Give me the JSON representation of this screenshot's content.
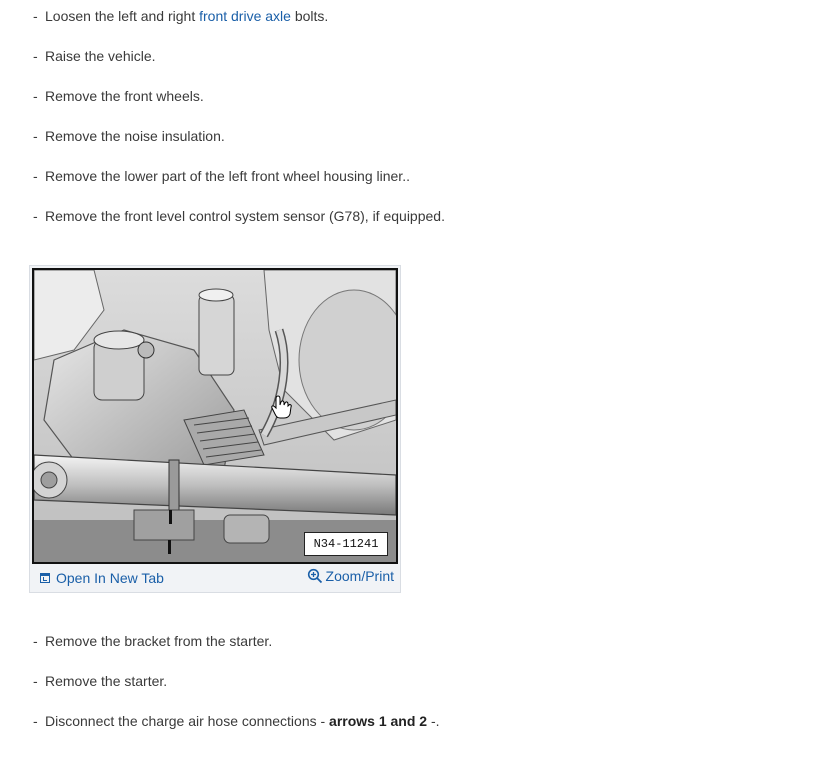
{
  "steps_top": [
    {
      "prefix": "Loosen the left and right ",
      "link": "front drive axle",
      "suffix": " bolts."
    },
    {
      "text": "Raise the vehicle."
    },
    {
      "text": "Remove the front wheels."
    },
    {
      "text": "Remove the noise insulation."
    },
    {
      "text": "Remove the lower part of the left front wheel housing liner.."
    },
    {
      "text": "Remove the front level control system sensor (G78), if equipped."
    }
  ],
  "dash": "-",
  "figure": {
    "label": "N34-11241",
    "open_tab_label": "Open In New Tab",
    "zoom_label": "Zoom/Print",
    "icons": [
      "open-new-tab-icon",
      "zoom-icon",
      "hand-cursor-icon"
    ]
  },
  "steps_bottom": [
    {
      "text": "Remove the bracket from the starter."
    },
    {
      "text": "Remove the starter."
    },
    {
      "prefix": "Disconnect the charge air hose connections - ",
      "bold": "arrows 1 and 2",
      "suffix": " -."
    }
  ],
  "colors": {
    "link": "#1a5fa8",
    "text": "#3a3a3a"
  }
}
